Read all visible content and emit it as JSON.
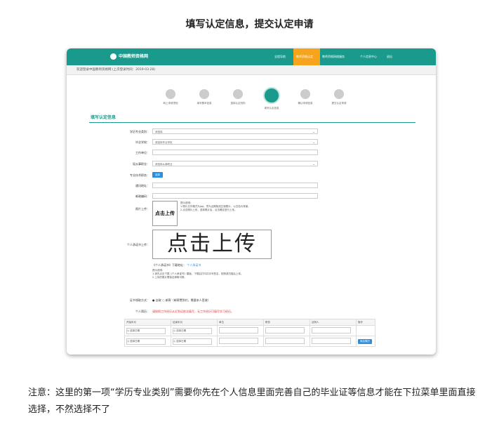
{
  "heading": "填写认定信息，提交认定申请",
  "site": {
    "logo_text": "中国教师资格网",
    "nav": [
      "全程导航",
      "教师资格认定",
      "教师资格网络服务",
      "个人信息中心",
      "退出"
    ],
    "sub_text": "欢迎登录中国教师资格网 (上次登录时间：2019-03-28)"
  },
  "steps": [
    "网上申请须知",
    "填写基本信息",
    "选择认定机构",
    "填写认定信息",
    "确认申请信息",
    "提交认定申请"
  ],
  "section_title": "填写认定信息",
  "form": {
    "edu_major_label": "学历专业类别：",
    "edu_major_value": "请选择",
    "school_label": "毕业学校：",
    "school_value": "请选择毕业学校",
    "work_unit_label": "工作单位：",
    "current_job_label": "现从事职业：",
    "current_job_value": "请选择从事职业",
    "tech_title_label": "专业技术职务：",
    "tech_title_btn": "选择",
    "address_label": "通讯地址：",
    "postcode_label": "邮政编码：",
    "photo_label": "照片上传：",
    "photo_upload_text": "点击上传",
    "photo_notes": "提示说明：\n1.照片文件格式为jpg，须为近期免冠正面照片，以白色为背景。\n2.点击照片上传，选择照片后，点击确定进行上传。",
    "resume_label": "个人承诺书上传：",
    "resume_upload_text": "点击上传",
    "resume_link_label": "《个人承诺书》下载地址：",
    "resume_link": "个人承诺书",
    "resume_notes": "提示说明：\n1.请先点击下载《个人承诺书》模板，下载后打印并手写签名，拍照或扫描后上传。\n2.上传的照片需保证清晰可辨。",
    "cert_method_label": "证书领取方式：",
    "cert_method_value": "● 自取  ○ 邮寄（邮寄费到付，需要本人签收）",
    "resume_entry_label": "个人简历：",
    "resume_entry_hint": "请按照工作经历从近到远依次填写，无工作经历可填写学习经历。",
    "table_headers": [
      "开始年月",
      "结束年月",
      "单位",
      "职务",
      "证明人",
      "操作"
    ],
    "pick_date": "◎ 选择日期",
    "add_btn": "添加简历"
  },
  "footnote": "注意：这里的第一项“学历专业类别”需要你先在个人信息里面完善自己的毕业证等信息才能在下拉菜单里面直接选择，不然选择不了"
}
